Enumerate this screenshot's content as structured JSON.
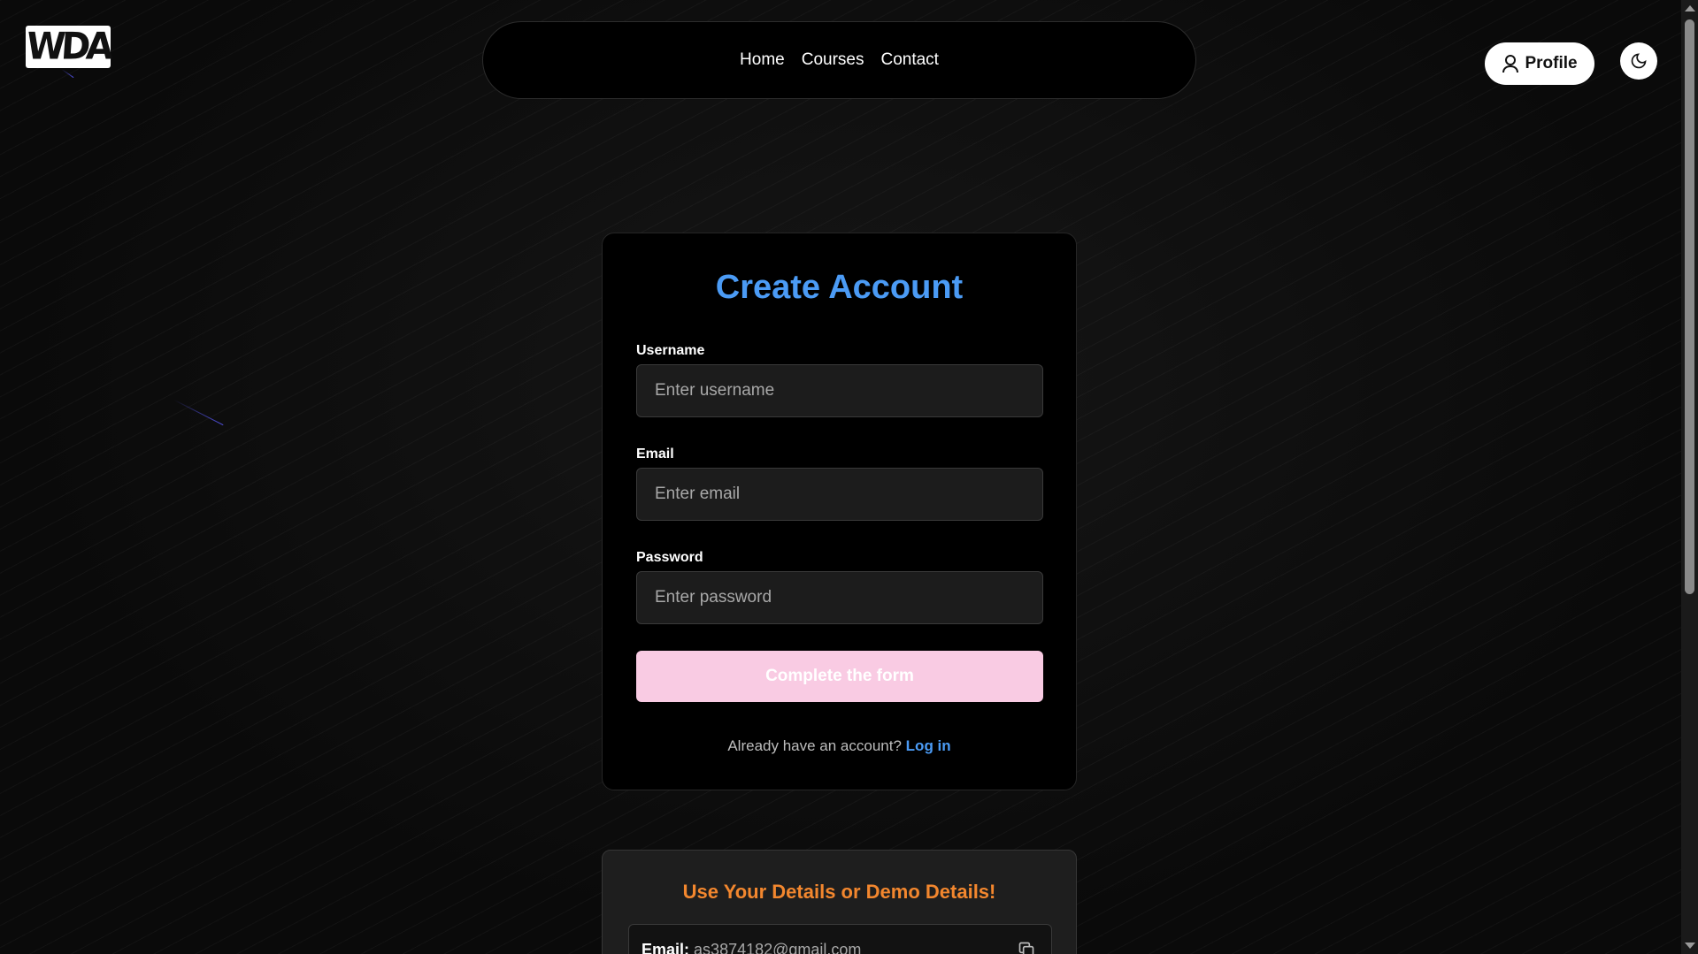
{
  "logo": {
    "text": "WDA"
  },
  "nav": {
    "items": [
      "Home",
      "Courses",
      "Contact"
    ]
  },
  "header": {
    "profile_label": "Profile"
  },
  "form": {
    "title": "Create Account",
    "username_label": "Username",
    "username_placeholder": "Enter username",
    "email_label": "Email",
    "email_placeholder": "Enter email",
    "password_label": "Password",
    "password_placeholder": "Enter password",
    "submit_label": "Complete the form",
    "login_prompt": "Already have an account?",
    "login_link": "Log in"
  },
  "demo": {
    "title": "Use Your Details or Demo Details!",
    "email_label": "Email:",
    "email_value": "as3874182@gmail.com"
  },
  "colors": {
    "accent_blue": "#4b9bf5",
    "submit_pink": "#f9cbe3",
    "demo_orange": "#f3872e"
  },
  "icons": [
    "user-icon",
    "moon-icon",
    "copy-icon"
  ]
}
